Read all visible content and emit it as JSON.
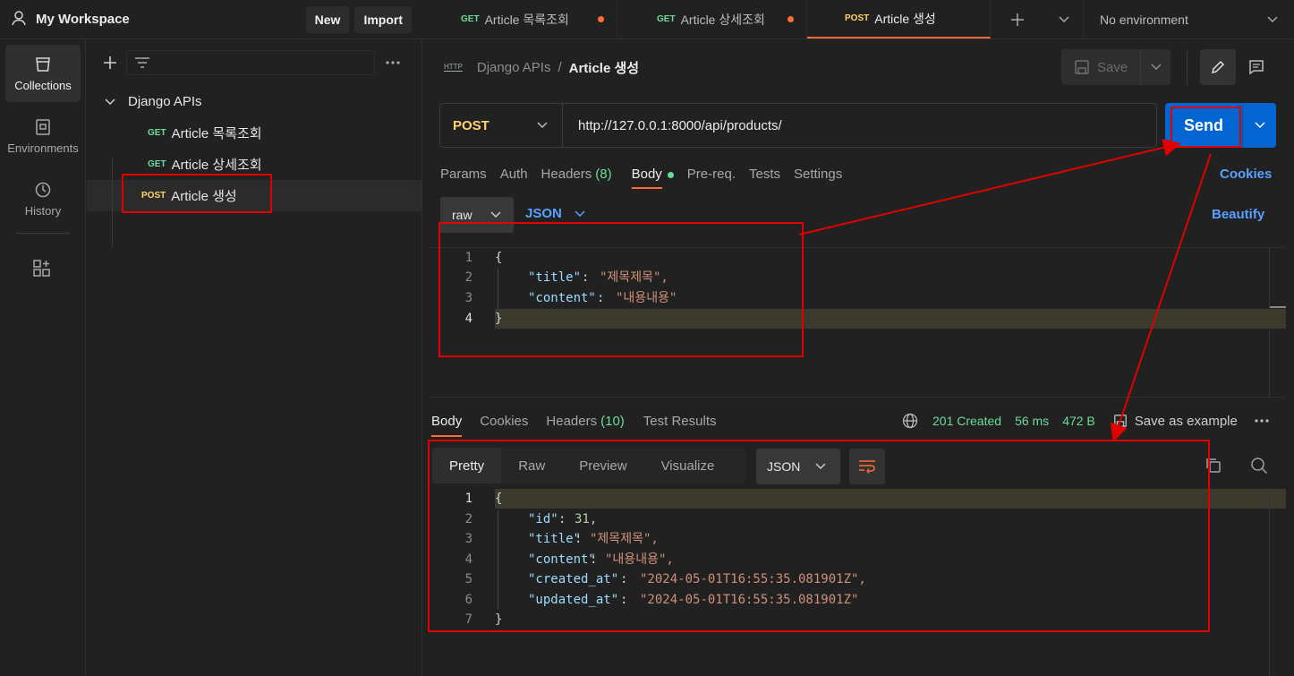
{
  "workspace": {
    "title": "My Workspace",
    "new_label": "New",
    "import_label": "Import"
  },
  "rail": {
    "items": [
      {
        "label": "Collections",
        "icon": "collections-icon",
        "active": true
      },
      {
        "label": "Environments",
        "icon": "environments-icon",
        "active": false
      },
      {
        "label": "History",
        "icon": "history-icon",
        "active": false
      }
    ]
  },
  "sidebar": {
    "collection": "Django APIs",
    "requests": [
      {
        "method": "GET",
        "name": "Article 목록조회"
      },
      {
        "method": "GET",
        "name": "Article 상세조회"
      },
      {
        "method": "POST",
        "name": "Article 생성"
      }
    ]
  },
  "tabs": [
    {
      "method": "GET",
      "name": "Article 목록조회"
    },
    {
      "method": "GET",
      "name": "Article 상세조회"
    },
    {
      "method": "POST",
      "name": "Article 생성"
    }
  ],
  "environment": "No environment",
  "breadcrumb": {
    "http_badge": "HTTP",
    "parent": "Django APIs",
    "separator": "/",
    "current": "Article 생성"
  },
  "save_label": "Save",
  "request": {
    "method": "POST",
    "url": "http://127.0.0.1:8000/api/products/",
    "send_label": "Send",
    "tabs": {
      "params": "Params",
      "auth": "Auth",
      "headers": "Headers",
      "headers_count": "(8)",
      "body": "Body",
      "prereq": "Pre-req.",
      "tests": "Tests",
      "settings": "Settings"
    },
    "cookies_link": "Cookies",
    "body_mode": "raw",
    "body_lang": "JSON",
    "beautify": "Beautify",
    "body_lines": [
      {
        "n": "1",
        "text": "{"
      },
      {
        "n": "2",
        "key": "\"title\"",
        "value": "\"제목제목\","
      },
      {
        "n": "3",
        "key": "\"content\"",
        "value": "\"내용내용\""
      },
      {
        "n": "4",
        "text": "}"
      }
    ]
  },
  "response": {
    "tabs": {
      "body": "Body",
      "cookies": "Cookies",
      "headers": "Headers",
      "headers_count": "(10)",
      "tests": "Test Results"
    },
    "status": "201 Created",
    "time": "56 ms",
    "size": "472 B",
    "save_example": "Save as example",
    "view_modes": [
      "Pretty",
      "Raw",
      "Preview",
      "Visualize"
    ],
    "format": "JSON",
    "body_lines": [
      {
        "n": "1",
        "text": "{"
      },
      {
        "n": "2",
        "key": "\"id\"",
        "value": "31,",
        "type": "num"
      },
      {
        "n": "3",
        "key": "\"title\"",
        "value": "\"제목제목\",",
        "type": "str"
      },
      {
        "n": "4",
        "key": "\"content\"",
        "value": "\"내용내용\",",
        "type": "str"
      },
      {
        "n": "5",
        "key": "\"created_at\"",
        "value": "\"2024-05-01T16:55:35.081901Z\",",
        "type": "str"
      },
      {
        "n": "6",
        "key": "\"updated_at\"",
        "value": "\"2024-05-01T16:55:35.081901Z\"",
        "type": "str"
      },
      {
        "n": "7",
        "text": "}"
      }
    ]
  },
  "colors": {
    "accent": "#ff6c37",
    "send": "#0265d2",
    "annotation": "#e00000",
    "status_ok": "#6bdd9a"
  }
}
